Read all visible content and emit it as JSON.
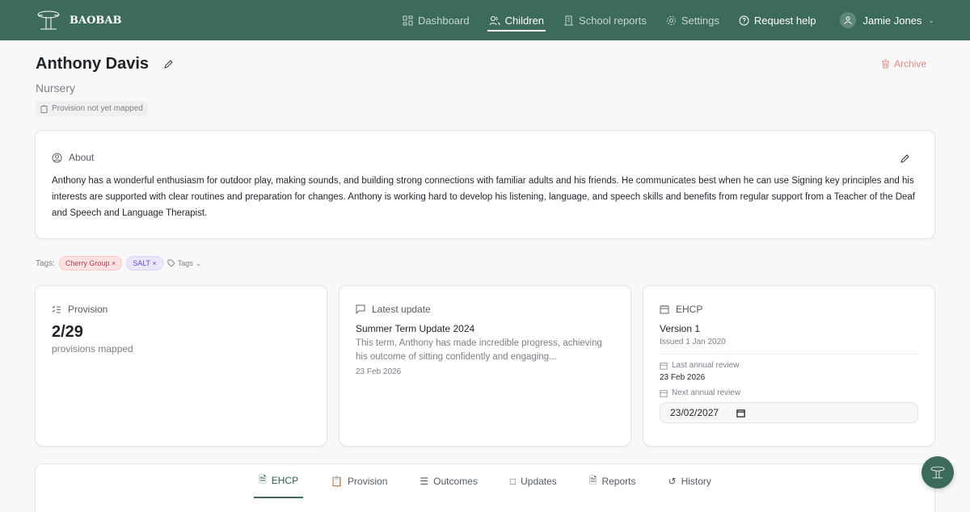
{
  "nav": {
    "brand": "BAOBAB",
    "items": [
      {
        "label": "Dashboard",
        "icon": "dashboard-icon"
      },
      {
        "label": "Children",
        "icon": "users-icon"
      },
      {
        "label": "School reports",
        "icon": "building-icon"
      },
      {
        "label": "Settings",
        "icon": "gear-icon"
      },
      {
        "label": "Request help",
        "icon": "help-icon"
      }
    ],
    "user": "Jamie Jones"
  },
  "child": {
    "name": "Anthony Davis",
    "group": "Nursery",
    "provision_status": "Provision not yet mapped",
    "archive": "Archive"
  },
  "about": {
    "title": "About",
    "text": "Anthony has a wonderful enthusiasm for outdoor play, making sounds, and building strong connections with familiar adults and his friends. He communicates best when he can use Signing key principles and his interests are supported with clear routines and preparation for changes. Anthony is working hard to develop his listening, language, and speech skills and benefits from regular support from a Teacher of the Deaf and Speech and Language Therapist."
  },
  "tags": {
    "label": "Tags:",
    "items": [
      "Cherry Group",
      "SALT"
    ],
    "add": "Tags"
  },
  "provision": {
    "title": "Provision",
    "value": "2/29",
    "caption": "provisions mapped"
  },
  "update": {
    "title": "Latest update",
    "heading": "Summer Term Update 2024",
    "text": "This term, Anthony has made incredible progress, achieving his outcome of sitting confidently and engaging...",
    "date": "23 Feb 2026"
  },
  "ehcp": {
    "title": "EHCP",
    "version": "Version 1",
    "issued": "Issued 1 Jan 2020",
    "last_label": "Last annual review",
    "last_date": "23 Feb 2026",
    "next_label": "Next annual review",
    "next_date": "23/02/2027"
  },
  "tabs": [
    "EHCP",
    "Provision",
    "Outcomes",
    "Updates",
    "Reports",
    "History"
  ]
}
